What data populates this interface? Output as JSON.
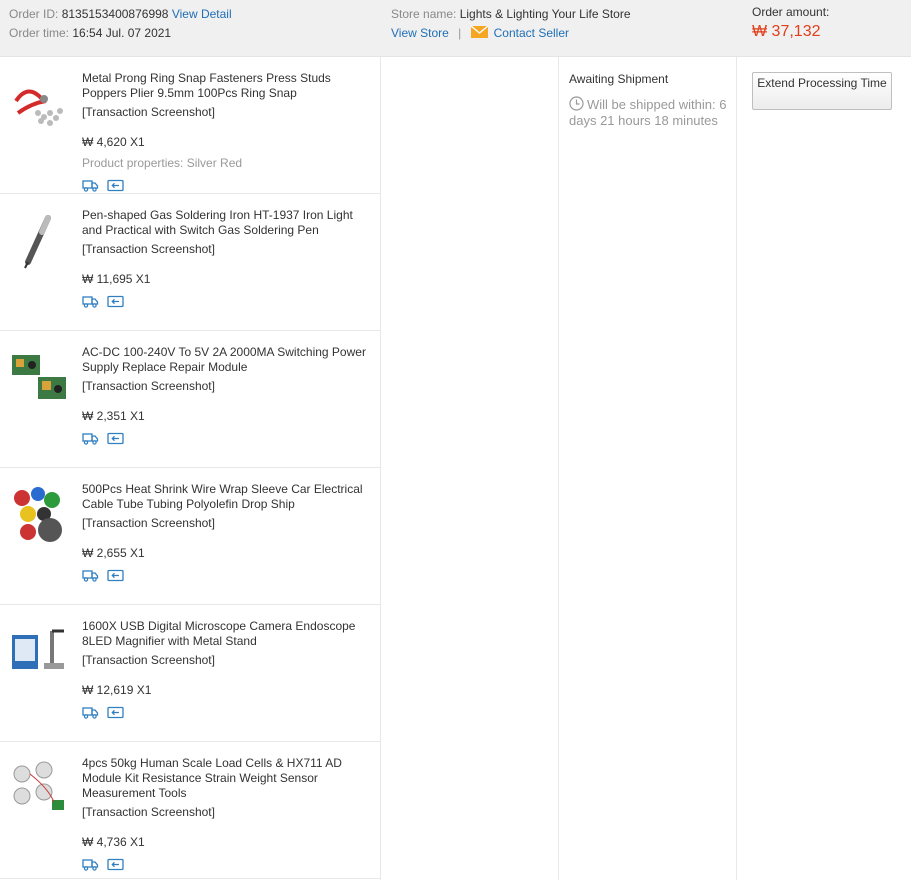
{
  "header": {
    "order_id_label": "Order ID:",
    "order_id": "8135153400876998",
    "view_detail": "View Detail",
    "order_time_label": "Order time:",
    "order_time": "16:54 Jul. 07 2021",
    "store_name_label": "Store name:",
    "store_name": "Lights & Lighting Your Life Store",
    "view_store": "View Store",
    "separator": "|",
    "contact_seller": "Contact Seller",
    "order_amount_label": "Order amount:",
    "order_amount": "₩ 37,132"
  },
  "items": [
    {
      "title": "Metal Prong Ring Snap Fasteners Press Studs Poppers Plier 9.5mm 100Pcs Ring Snap",
      "snapshot": "[Transaction Screenshot]",
      "price": "₩ 4,620 X1",
      "props": "Product properties: Silver Red"
    },
    {
      "title": "Pen-shaped Gas Soldering Iron HT-1937 Iron Light and Practical with Switch Gas Soldering Pen",
      "snapshot": "[Transaction Screenshot]",
      "price": "₩ 11,695 X1",
      "props": ""
    },
    {
      "title": "AC-DC 100-240V To 5V 2A 2000MA Switching Power Supply Replace Repair Module",
      "snapshot": "[Transaction Screenshot]",
      "price": "₩ 2,351 X1",
      "props": ""
    },
    {
      "title": "500Pcs Heat Shrink Wire Wrap Sleeve Car Electrical Cable Tube Tubing Polyolefin Drop Ship",
      "snapshot": "[Transaction Screenshot]",
      "price": "₩ 2,655 X1",
      "props": ""
    },
    {
      "title": "1600X USB Digital Microscope Camera Endoscope 8LED Magnifier with Metal Stand",
      "snapshot": "[Transaction Screenshot]",
      "price": "₩ 12,619 X1",
      "props": ""
    },
    {
      "title": "4pcs 50kg Human Scale Load Cells & HX711 AD Module Kit Resistance Strain Weight Sensor Measurement Tools",
      "snapshot": "[Transaction Screenshot]",
      "price": "₩ 4,736 X1",
      "props": ""
    }
  ],
  "status": {
    "title": "Awaiting Shipment",
    "ship_note": "Will be shipped within: 6 days 21 hours 18 minutes"
  },
  "actions": {
    "extend_processing_time": "Extend Processing Time"
  },
  "icons": {
    "mail": "mail-icon",
    "clock": "clock-icon",
    "shipping": "truck-icon",
    "return": "return-icon"
  },
  "colors": {
    "link": "#1f6fb6",
    "amount": "#e0401c",
    "header_bg": "#f0f0f0",
    "icon_blue": "#2f7fc1",
    "mail_orange": "#f5a623"
  }
}
